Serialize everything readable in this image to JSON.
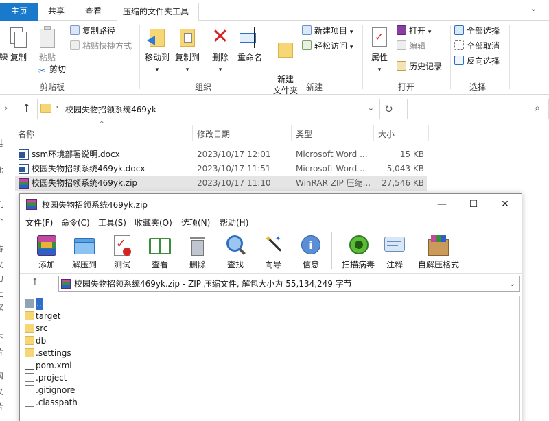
{
  "explorer": {
    "tabs": [
      "主页",
      "共享",
      "查看",
      "压缩的文件夹工具"
    ],
    "top_right_icon": "chevron-down-icon",
    "ribbon": {
      "clipboard": {
        "copy": "复制",
        "paste": "粘贴",
        "copy_path": "复制路径",
        "paste_shortcut": "粘贴快捷方式",
        "cut": "剪切",
        "label": "剪贴板"
      },
      "organize": {
        "move_to": "移动到",
        "copy_to": "复制到",
        "delete": "删除",
        "rename": "重命名",
        "label": "组织"
      },
      "new": {
        "new_folder": "新建\n文件夹",
        "new_item": "新建项目",
        "easy_access": "轻松访问",
        "label": "新建"
      },
      "open": {
        "properties": "属性",
        "open": "打开",
        "edit": "编辑",
        "history": "历史记录",
        "label": "打开"
      },
      "select": {
        "select_all": "全部选择",
        "select_none": "全部取消",
        "invert": "反向选择",
        "label": "选择"
      }
    },
    "address": {
      "path": "校园失物招领系统469yk"
    },
    "columns": {
      "name": "名称",
      "date": "修改日期",
      "type": "类型",
      "size": "大小"
    },
    "files": [
      {
        "name": "ssm环境部署说明.docx",
        "date": "2023/10/17 12:01",
        "type": "Microsoft Word ...",
        "size": "15 KB",
        "icon": "word-icon"
      },
      {
        "name": "校园失物招领系统469yk.docx",
        "date": "2023/10/17 11:51",
        "type": "Microsoft Word ...",
        "size": "5,043 KB",
        "icon": "word-icon"
      },
      {
        "name": "校园失物招领系统469yk.zip",
        "date": "2023/10/17 11:10",
        "type": "WinRAR ZIP 压缩...",
        "size": "27,546 KB",
        "icon": "winrar-icon",
        "selected": true
      }
    ],
    "edge_chars": [
      "决",
      "生",
      "比",
      "几",
      "卜",
      "诗",
      "义",
      "刀",
      "上",
      "家",
      "十",
      "下",
      "片",
      "网",
      "义",
      "片"
    ]
  },
  "winrar": {
    "title": "校园失物招领系统469yk.zip",
    "menu": [
      "文件(F)",
      "命令(C)",
      "工具(S)",
      "收藏夹(O)",
      "选项(N)",
      "帮助(H)"
    ],
    "toolbar": [
      "添加",
      "解压到",
      "测试",
      "查看",
      "删除",
      "查找",
      "向导",
      "信息",
      "扫描病毒",
      "注释",
      "自解压格式"
    ],
    "path": "校园失物招领系统469yk.zip - ZIP 压缩文件, 解包大小为 55,134,249 字节",
    "entries": [
      {
        "name": "..",
        "kind": "up"
      },
      {
        "name": "target",
        "kind": "folder"
      },
      {
        "name": "src",
        "kind": "folder"
      },
      {
        "name": "db",
        "kind": "folder"
      },
      {
        "name": ".settings",
        "kind": "folder"
      },
      {
        "name": "pom.xml",
        "kind": "xml"
      },
      {
        "name": ".project",
        "kind": "file"
      },
      {
        "name": ".gitignore",
        "kind": "file"
      },
      {
        "name": ".classpath",
        "kind": "file"
      }
    ]
  }
}
